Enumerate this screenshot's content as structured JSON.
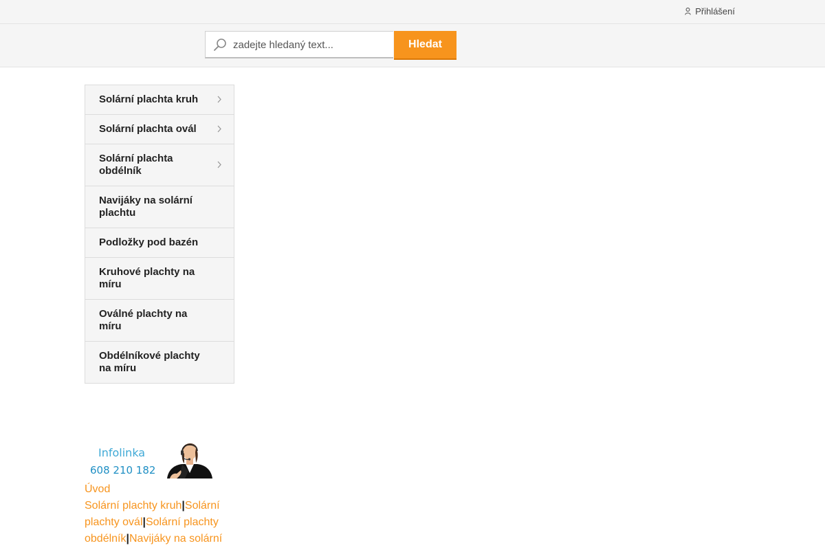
{
  "topbar": {
    "login_label": "Přihlášení"
  },
  "search": {
    "placeholder": "zadejte hledaný text...",
    "button_label": "Hledat"
  },
  "categories": [
    {
      "label": "Solární plachta kruh",
      "has_submenu": true
    },
    {
      "label": "Solární plachta ovál",
      "has_submenu": true
    },
    {
      "label": "Solární plachta obdélník",
      "has_submenu": true
    },
    {
      "label": "Navijáky na solární plachtu",
      "has_submenu": false
    },
    {
      "label": "Podložky pod bazén",
      "has_submenu": false
    },
    {
      "label": "Kruhové plachty na míru",
      "has_submenu": false
    },
    {
      "label": "Oválné plachty na míru",
      "has_submenu": false
    },
    {
      "label": "Obdélníkové plachty na míru",
      "has_submenu": false
    }
  ],
  "infoline": {
    "label": "Infolinka",
    "phone": "608 210 182"
  },
  "footer": {
    "home": "Úvod",
    "links": [
      "Solární plachty kruh",
      "Solární plachty ovál",
      "Solární plachty obdélník",
      "Navijáky na solární"
    ],
    "separator": "|"
  },
  "colors": {
    "accent": "#f7941d",
    "info_blue": "#3fa9d6"
  }
}
